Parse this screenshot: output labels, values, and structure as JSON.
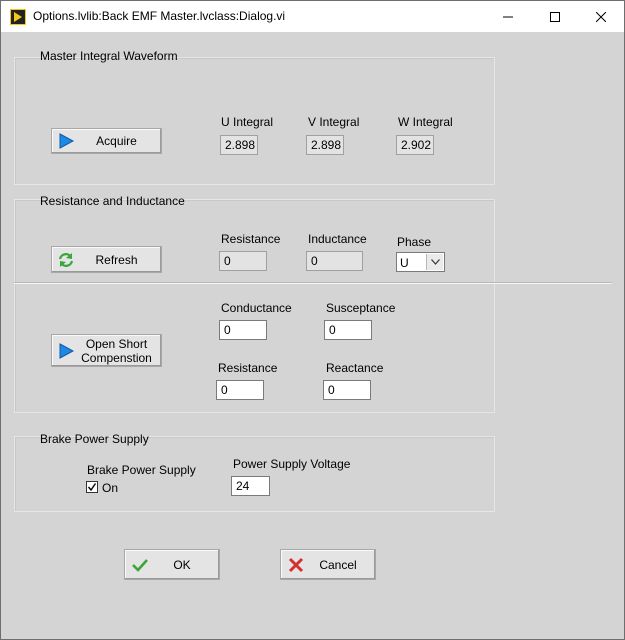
{
  "window": {
    "title": "Options.lvlib:Back EMF Master.lvclass:Dialog.vi",
    "minimize_symbol": "–",
    "maximize_symbol": "☐",
    "close_symbol": "✕"
  },
  "master_integral": {
    "title": "Master Integral Waveform",
    "acquire_label": "Acquire",
    "acquire_icon": "play-icon",
    "u_label": "U Integral",
    "u_value": "2.898",
    "v_label": "V Integral",
    "v_value": "2.898",
    "w_label": "W Integral",
    "w_value": "2.902"
  },
  "resistance_inductance": {
    "title": "Resistance and Inductance",
    "refresh_label": "Refresh",
    "refresh_icon": "refresh-icon",
    "resistance_label": "Resistance",
    "resistance_value": "0",
    "inductance_label": "Inductance",
    "inductance_value": "0",
    "phase_label": "Phase",
    "phase_value": "U"
  },
  "compensation": {
    "open_short_label": "Open Short Compenstion",
    "conductance_label": "Conductance",
    "conductance_value": "0",
    "susceptance_label": "Susceptance",
    "susceptance_value": "0",
    "resistance_label": "Resistance",
    "resistance_value": "0",
    "reactance_label": "Reactance",
    "reactance_value": "0"
  },
  "brake": {
    "title": "Brake Power Supply",
    "supply_label": "Brake Power Supply",
    "on_label": "On",
    "on_checked": true,
    "voltage_label": "Power Supply Voltage",
    "voltage_value": "24"
  },
  "footer": {
    "ok_label": "OK",
    "cancel_label": "Cancel"
  },
  "colors": {
    "background": "#d4d4d4",
    "play_blue": "#1e88e5",
    "ok_green": "#3aa63a",
    "cancel_red": "#d32f2f"
  }
}
